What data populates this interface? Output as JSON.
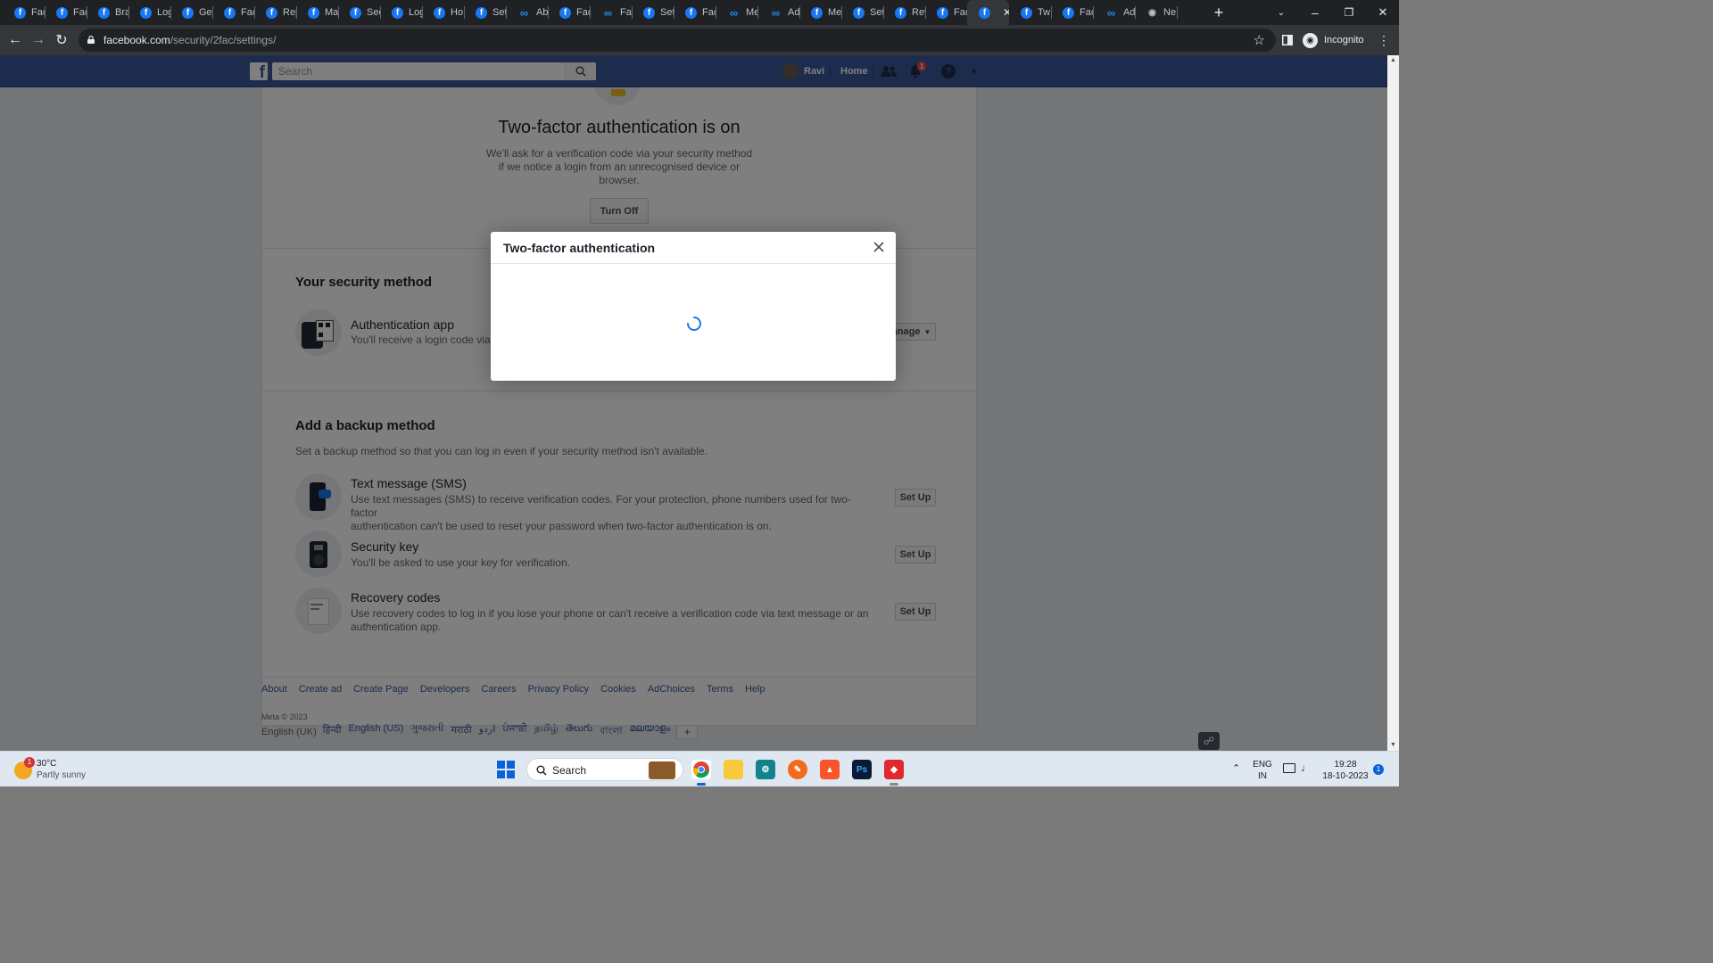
{
  "browser": {
    "tabs": [
      {
        "title": "Fac",
        "icon": "facebook"
      },
      {
        "title": "Fac",
        "icon": "facebook"
      },
      {
        "title": "Bra",
        "icon": "facebook"
      },
      {
        "title": "Log",
        "icon": "facebook"
      },
      {
        "title": "Get",
        "icon": "facebook"
      },
      {
        "title": "Fac",
        "icon": "facebook"
      },
      {
        "title": "Rep",
        "icon": "facebook"
      },
      {
        "title": "Ma",
        "icon": "facebook"
      },
      {
        "title": "Sec",
        "icon": "facebook"
      },
      {
        "title": "Log",
        "icon": "facebook"
      },
      {
        "title": "Ho",
        "icon": "facebook"
      },
      {
        "title": "Set",
        "icon": "facebook"
      },
      {
        "title": "Abc",
        "icon": "meta"
      },
      {
        "title": "Fac",
        "icon": "facebook"
      },
      {
        "title": "Fac",
        "icon": "meta"
      },
      {
        "title": "Set",
        "icon": "facebook"
      },
      {
        "title": "Fac",
        "icon": "facebook"
      },
      {
        "title": "Me",
        "icon": "meta"
      },
      {
        "title": "Ad",
        "icon": "meta"
      },
      {
        "title": "Me",
        "icon": "facebook"
      },
      {
        "title": "Set",
        "icon": "facebook"
      },
      {
        "title": "Rev",
        "icon": "facebook"
      },
      {
        "title": "Fac",
        "icon": "facebook"
      },
      {
        "title": "",
        "icon": "facebook",
        "active": true
      },
      {
        "title": "Tw",
        "icon": "facebook"
      },
      {
        "title": "Fac",
        "icon": "facebook"
      },
      {
        "title": "Ads",
        "icon": "meta"
      },
      {
        "title": "Ne",
        "icon": "incognito"
      }
    ],
    "url_host": "facebook.com",
    "url_path": "/security/2fac/settings/",
    "incognito_label": "Incognito"
  },
  "fb": {
    "search_placeholder": "Search",
    "user_name": "Ravi",
    "home_label": "Home",
    "notification_count": "1"
  },
  "hero": {
    "title": "Two-factor authentication is on",
    "desc_lines": [
      "We'll ask for a verification code via your security method",
      "if we notice a login from an unrecognised device or",
      "browser."
    ],
    "turn_off": "Turn Off"
  },
  "security_method": {
    "heading": "Your security method",
    "name": "Authentication app",
    "desc": "You'll receive a login code via a",
    "manage": "anage"
  },
  "backup": {
    "heading": "Add a backup method",
    "intro": "Set a backup method so that you can log in even if your security method isn't available.",
    "items": [
      {
        "title": "Text message (SMS)",
        "lines": [
          "Use text messages (SMS) to receive verification codes. For your protection, phone numbers used for two-factor",
          "authentication can't be used to reset your password when two-factor authentication is on."
        ],
        "button": "Set Up"
      },
      {
        "title": "Security key",
        "lines": [
          "You'll be asked to use your key for verification."
        ],
        "button": "Set Up"
      },
      {
        "title": "Recovery codes",
        "lines": [
          "Use recovery codes to log in if you lose your phone or can't receive a verification code via text message or an",
          "authentication app."
        ],
        "button": "Set Up"
      }
    ]
  },
  "footer": {
    "links": [
      "About",
      "Create ad",
      "Create Page",
      "Developers",
      "Careers",
      "Privacy Policy",
      "Cookies",
      "AdChoices",
      "Terms",
      "Help"
    ],
    "copyright": "Meta © 2023",
    "current_language": "English (UK)",
    "languages": [
      "हिन्दी",
      "English (US)",
      "ગુજરાતી",
      "मराठी",
      "اردو",
      "ਪੰਜਾਬੀ",
      "தமிழ்",
      "తెలుగు",
      "বাংলা",
      "മലയാളം"
    ]
  },
  "dialog": {
    "title": "Two-factor authentication"
  },
  "taskbar": {
    "weather_temp": "30°C",
    "weather_desc": "Partly sunny",
    "weather_badge": "1",
    "search_label": "Search",
    "lang_line1": "ENG",
    "lang_line2": "IN",
    "time": "19:28",
    "date": "18-10-2023",
    "notif_count": "1"
  },
  "colors": {
    "fb_blue": "#3b5998",
    "chrome_dark": "#202124",
    "link": "#385898",
    "spinner": "#1877f2"
  }
}
